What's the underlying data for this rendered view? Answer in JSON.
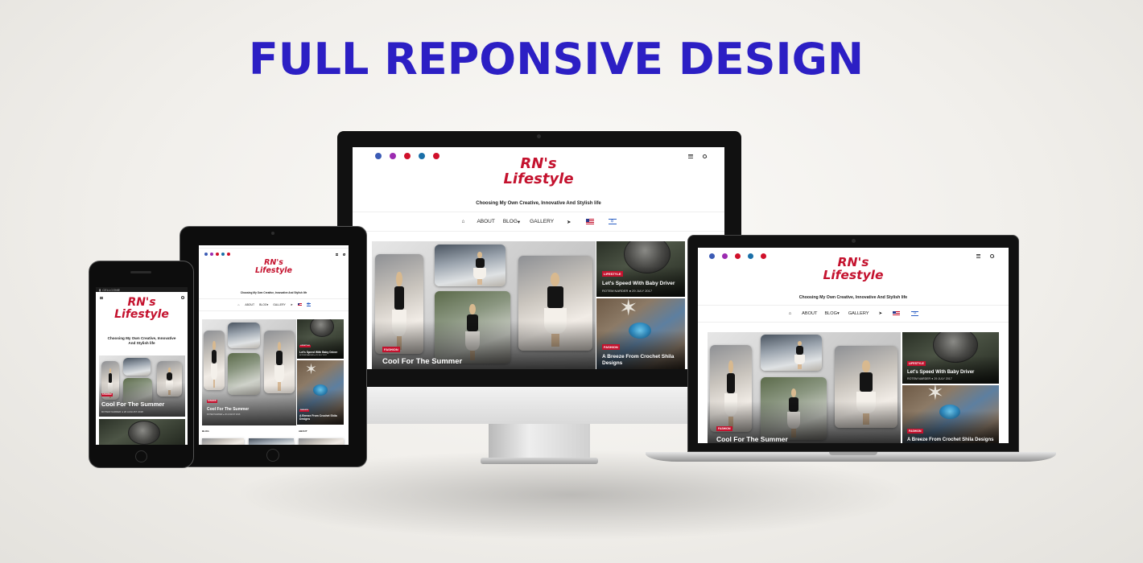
{
  "headline": "FULL REPONSIVE DESIGN",
  "colors": {
    "headline": "#2c1fc4",
    "brand_red": "#c4122e"
  },
  "site": {
    "logo_line1": "RN's",
    "logo_line2": "Lifestyle",
    "tagline": "Choosing My Own Creative, Innovative And Stylish life",
    "tagline_line1": "Choosing My Own Creative, Innovative",
    "tagline_line2": "And Stylish life",
    "social_icons": [
      "facebook-icon",
      "instagram-icon",
      "youtube-icon",
      "pinterest-icon",
      "youtube-icon"
    ],
    "menu": {
      "home_icon": "home-icon",
      "about": "ABOUT",
      "blog": "BLOG",
      "blog_caret": "▾",
      "gallery": "GALLERY",
      "send_icon": "paper-plane-icon",
      "flag_us": "us-flag-icon",
      "flag_il": "israel-flag-icon"
    },
    "featured": {
      "category": "FASHION",
      "title": "Cool For The Summer",
      "author": "ROTEM NARDER",
      "date": "20 AUGUST 2018"
    },
    "side_posts": [
      {
        "category": "LIFESTYLE",
        "title": "Let's Speed With Baby Driver",
        "author": "ROTEM NARDER",
        "date": "29 JULY 2017"
      },
      {
        "category": "FASHION",
        "title": "A Breeze From Crochet Shila Designs"
      }
    ],
    "tablet_sections": {
      "left": "BLOG",
      "right": "ABOUT"
    }
  },
  "phone": {
    "carrier": "CELLCOME"
  }
}
